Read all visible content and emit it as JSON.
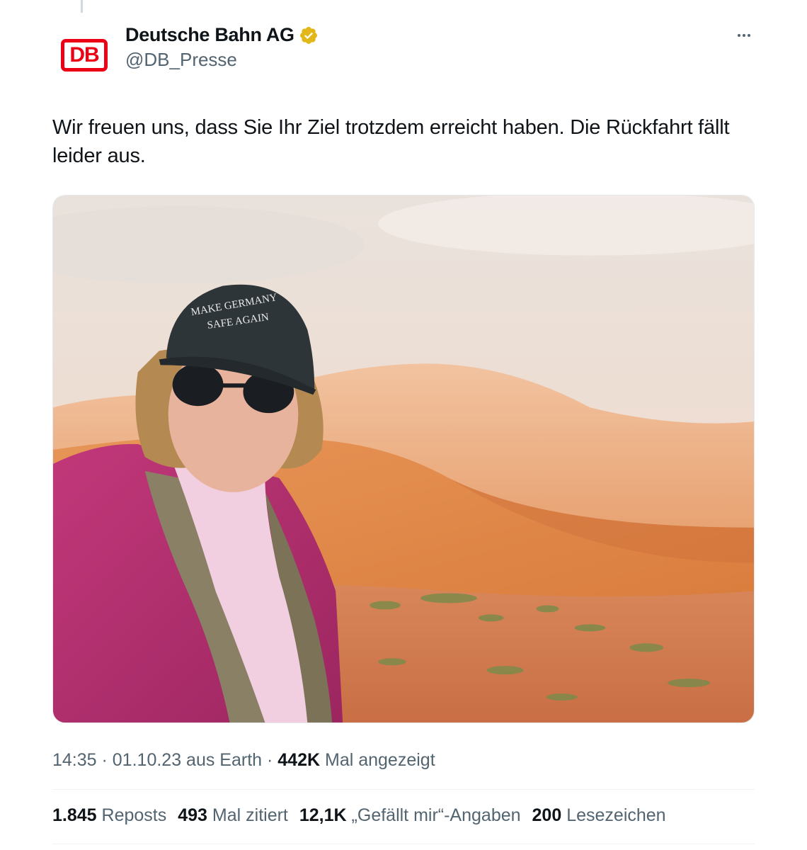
{
  "author": {
    "display_name": "Deutsche Bahn AG",
    "handle": "@DB_Presse",
    "logo_text": "DB",
    "verified_badge": "verified-gold-badge",
    "verified_color": "#e2b719"
  },
  "tweet": {
    "text": "Wir freuen uns, dass Sie Ihr Ziel trotzdem erreicht haben. Die Rückfahrt fällt leider aus.",
    "media": {
      "cap_text_line1": "MAKE GERMANY",
      "cap_text_line2": "SAFE AGAIN"
    }
  },
  "meta": {
    "time": "14:35",
    "sep1": " · ",
    "date": "01.10.23",
    "source": " aus Earth",
    "sep2": " · ",
    "views": "442K",
    "views_label": " Mal angezeigt"
  },
  "stats": {
    "reposts": {
      "value": "1.845",
      "label": "Reposts"
    },
    "quotes": {
      "value": "493",
      "label": "Mal zitiert"
    },
    "likes": {
      "value": "12,1K",
      "label": "„Gefällt mir“-Angaben"
    },
    "bookmarks": {
      "value": "200",
      "label": "Lesezeichen"
    }
  },
  "colors": {
    "brand_red": "#ec0016",
    "text_primary": "#0f1419",
    "text_secondary": "#536471"
  },
  "icons": {
    "more": "more-horizontal-icon"
  }
}
